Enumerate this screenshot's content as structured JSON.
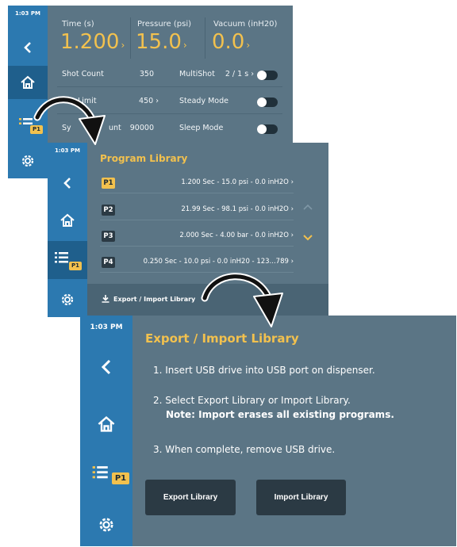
{
  "screen1": {
    "time": "1:03 PM",
    "columns": [
      {
        "label": "Time (s)",
        "value": "1.200"
      },
      {
        "label": "Pressure (psi)",
        "value": "15.0"
      },
      {
        "label": "Vacuum (inH20)",
        "value": "0.0"
      }
    ],
    "rows_left": [
      {
        "label": "Shot Count",
        "value": "350"
      },
      {
        "label": "Limit",
        "value": "450"
      },
      {
        "label": "Sy",
        "label2": "unt",
        "value": "90000"
      }
    ],
    "rows_right": [
      {
        "label": "MultiShot",
        "value": "2 / 1 s"
      },
      {
        "label": "Steady Mode"
      },
      {
        "label": "Sleep Mode"
      }
    ],
    "program_badge": "P1"
  },
  "screen2": {
    "time": "1:03 PM",
    "title": "Program Library",
    "programs": [
      {
        "id": "P1",
        "text": "1.200 Sec - 15.0 psi - 0.0 inH2O",
        "selected": true
      },
      {
        "id": "P2",
        "text": "21.99 Sec - 98.1 psi - 0.0 inH2O",
        "selected": false
      },
      {
        "id": "P3",
        "text": "2.000 Sec - 4.00 bar - 0.0 inH2O",
        "selected": false
      },
      {
        "id": "P4",
        "text": "0.250 Sec - 10.0 psi - 0.0 inH20 - 123...789",
        "selected": false
      }
    ],
    "export_label": "Export / Import Library",
    "program_badge": "P1"
  },
  "screen3": {
    "time": "1:03 PM",
    "title": "Export / Import Library",
    "step1": "1. Insert USB drive into USB port on dispenser.",
    "step2": "2. Select Export Library or Import Library.",
    "note": "Note: Import erases all existing programs.",
    "step3": "3. When complete, remove USB drive.",
    "export_button": "Export Library",
    "import_button": "Import Library",
    "program_badge": "P1"
  },
  "colors": {
    "accent": "#f2c14e",
    "sidebar": "#2c79b0",
    "panel": "#5b7585",
    "dark_button": "#2b3a44"
  }
}
